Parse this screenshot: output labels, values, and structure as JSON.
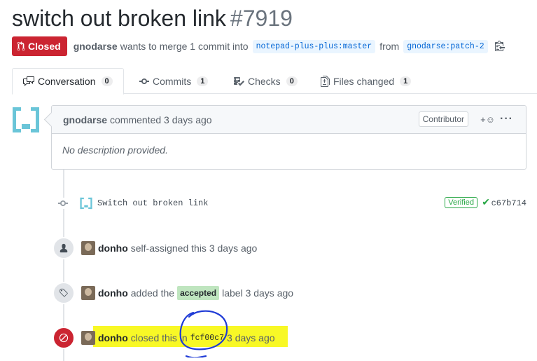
{
  "header": {
    "title": "switch out broken link",
    "number": "#7919"
  },
  "meta": {
    "state": "Closed",
    "author": "gnodarse",
    "text_merge": "wants to merge 1 commit into",
    "base_branch": "notepad-plus-plus:master",
    "text_from": "from",
    "head_branch": "gnodarse:patch-2"
  },
  "tabs": [
    {
      "label": "Conversation",
      "count": "0",
      "icon": "comment-discussion-icon"
    },
    {
      "label": "Commits",
      "count": "1",
      "icon": "git-commit-icon"
    },
    {
      "label": "Checks",
      "count": "0",
      "icon": "checklist-icon"
    },
    {
      "label": "Files changed",
      "count": "1",
      "icon": "file-diff-icon"
    }
  ],
  "comment": {
    "author": "gnodarse",
    "action": "commented 3 days ago",
    "role": "Contributor",
    "reaction": "+☺",
    "menu": "···",
    "body": "No description provided."
  },
  "commit": {
    "message": "Switch out broken link",
    "verified": "Verified",
    "sha": "c67b714"
  },
  "events": [
    {
      "icon": "person-icon",
      "user": "donho",
      "text": "self-assigned this 3 days ago"
    },
    {
      "icon": "tag-icon",
      "user": "donho",
      "text_before": "added the",
      "label": "accepted",
      "text_after": "label 3 days ago"
    },
    {
      "icon": "circle-slash-icon",
      "user": "donho",
      "text_before": "closed this in",
      "sha": "fcf00c7",
      "text_after": "3 days ago"
    }
  ],
  "colors": {
    "closed_red": "#cb2431",
    "label_accepted": "#bfe5bf",
    "highlight": "#f7f700",
    "pen": "#1f3bd6"
  }
}
